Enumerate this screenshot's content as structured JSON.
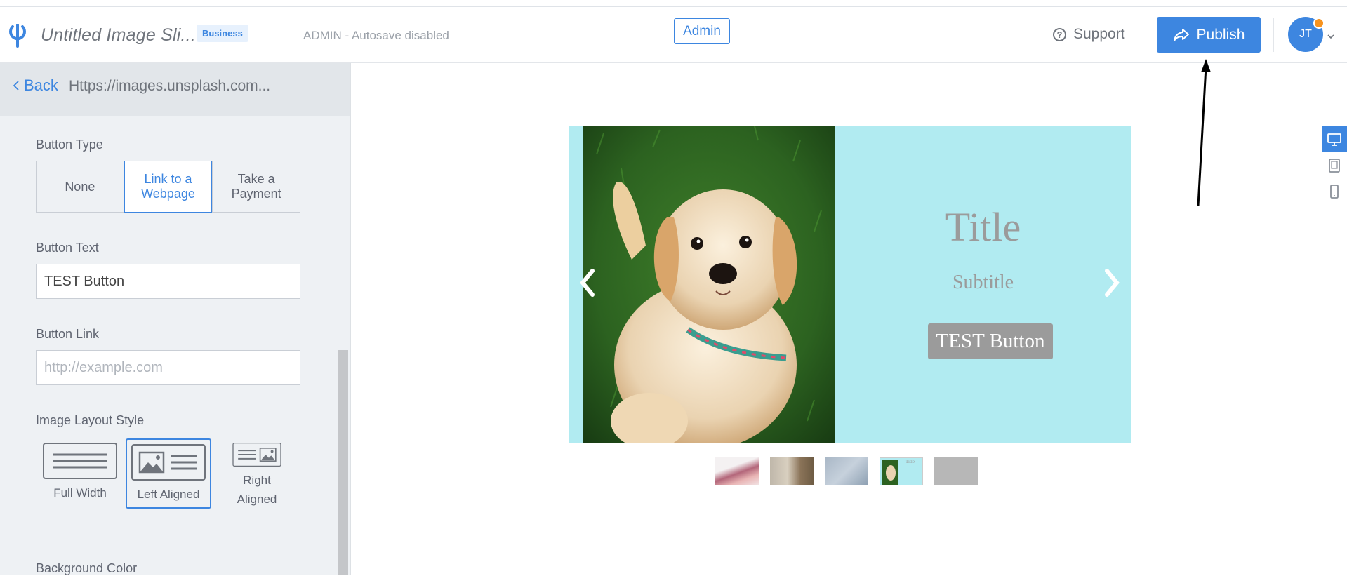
{
  "header": {
    "doc_title": "Untitled Image Sli...",
    "plan_badge": "Business",
    "autosave_status": "ADMIN - Autosave disabled",
    "admin_button": "Admin",
    "support_label": "Support",
    "publish_label": "Publish",
    "avatar_initials": "JT"
  },
  "sidebar": {
    "back_label": "Back",
    "image_url": "Https://images.unsplash.com...",
    "button_type_label": "Button Type",
    "button_type_options": [
      "None",
      "Link to a Webpage",
      "Take a Payment"
    ],
    "button_type_selected": "Link to a Webpage",
    "button_text_label": "Button Text",
    "button_text_value": "TEST Button",
    "button_link_label": "Button Link",
    "button_link_placeholder": "http://example.com",
    "layout_style_label": "Image Layout Style",
    "layout_options": [
      "Full Width",
      "Left Aligned",
      "Right Aligned"
    ],
    "layout_selected": "Left Aligned",
    "background_color_label": "Background Color"
  },
  "slide": {
    "title": "Title",
    "subtitle": "Subtitle",
    "button_text": "TEST Button",
    "background_color": "#b1ebf1",
    "text_color": "#9b9b9b"
  },
  "thumbnails": [
    {
      "name": "thumb-1",
      "selected": false
    },
    {
      "name": "thumb-2",
      "selected": false
    },
    {
      "name": "thumb-3",
      "selected": false
    },
    {
      "name": "thumb-4",
      "selected": true,
      "mini_title": "Title"
    },
    {
      "name": "thumb-5",
      "selected": false
    }
  ],
  "device_preview": [
    "desktop-icon",
    "tablet-icon",
    "mobile-icon"
  ],
  "colors": {
    "accent": "#3d86e0",
    "sidebar_bg": "#eef1f4",
    "badge_dot": "#f7931e"
  }
}
